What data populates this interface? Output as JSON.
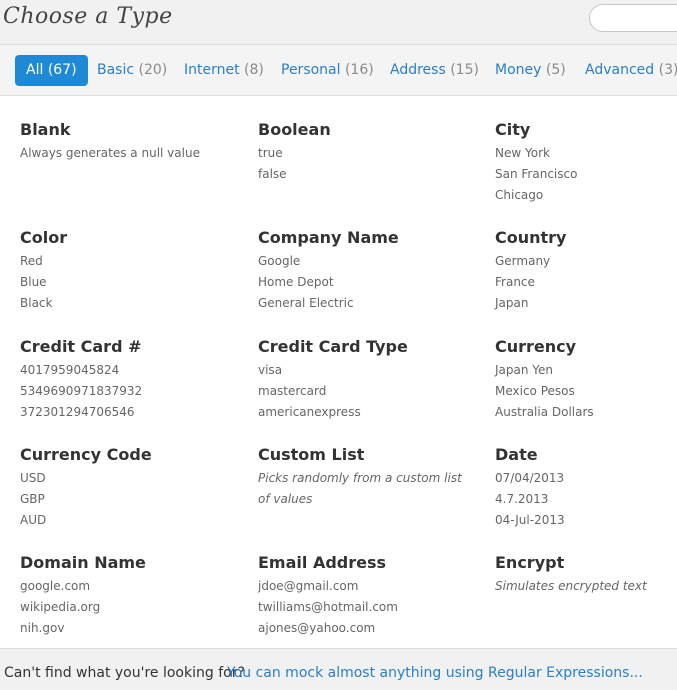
{
  "header": {
    "title": "Choose a Type",
    "search_placeholder": ""
  },
  "tabs": [
    {
      "label": "All",
      "count": "(67)",
      "active": true
    },
    {
      "label": "Basic",
      "count": "(20)"
    },
    {
      "label": "Internet",
      "count": "(8)"
    },
    {
      "label": "Personal",
      "count": "(16)"
    },
    {
      "label": "Address",
      "count": "(15)"
    },
    {
      "label": "Money",
      "count": "(5)"
    },
    {
      "label": "Advanced",
      "count": "(3)"
    }
  ],
  "types": [
    {
      "name": "Blank",
      "examples": [
        "Always generates a null value"
      ]
    },
    {
      "name": "Boolean",
      "examples": [
        "true",
        "false"
      ]
    },
    {
      "name": "City",
      "examples": [
        "New York",
        "San Francisco",
        "Chicago"
      ]
    },
    {
      "name": "Color",
      "examples": [
        "Red",
        "Blue",
        "Black"
      ]
    },
    {
      "name": "Company Name",
      "examples": [
        "Google",
        "Home Depot",
        "General Electric"
      ]
    },
    {
      "name": "Country",
      "examples": [
        "Germany",
        "France",
        "Japan"
      ]
    },
    {
      "name": "Credit Card #",
      "examples": [
        "4017959045824",
        "5349690971837932",
        "372301294706546"
      ]
    },
    {
      "name": "Credit Card Type",
      "examples": [
        "visa",
        "mastercard",
        "americanexpress"
      ]
    },
    {
      "name": "Currency",
      "examples": [
        "Japan Yen",
        "Mexico Pesos",
        "Australia Dollars"
      ]
    },
    {
      "name": "Currency Code",
      "examples": [
        "USD",
        "GBP",
        "AUD"
      ]
    },
    {
      "name": "Custom List",
      "note": "Picks randomly from a custom list of values"
    },
    {
      "name": "Date",
      "examples": [
        "07/04/2013",
        "4.7.2013",
        "04-Jul-2013"
      ]
    },
    {
      "name": "Domain Name",
      "examples": [
        "google.com",
        "wikipedia.org",
        "nih.gov"
      ]
    },
    {
      "name": "Email Address",
      "examples": [
        "jdoe@gmail.com",
        "twilliams@hotmail.com",
        "ajones@yahoo.com"
      ]
    },
    {
      "name": "Encrypt",
      "note": "Simulates encrypted text"
    }
  ],
  "footer": {
    "question": "Can't find what you're looking for?",
    "regex_link": "You can mock almost anything using Regular Expressions..."
  }
}
